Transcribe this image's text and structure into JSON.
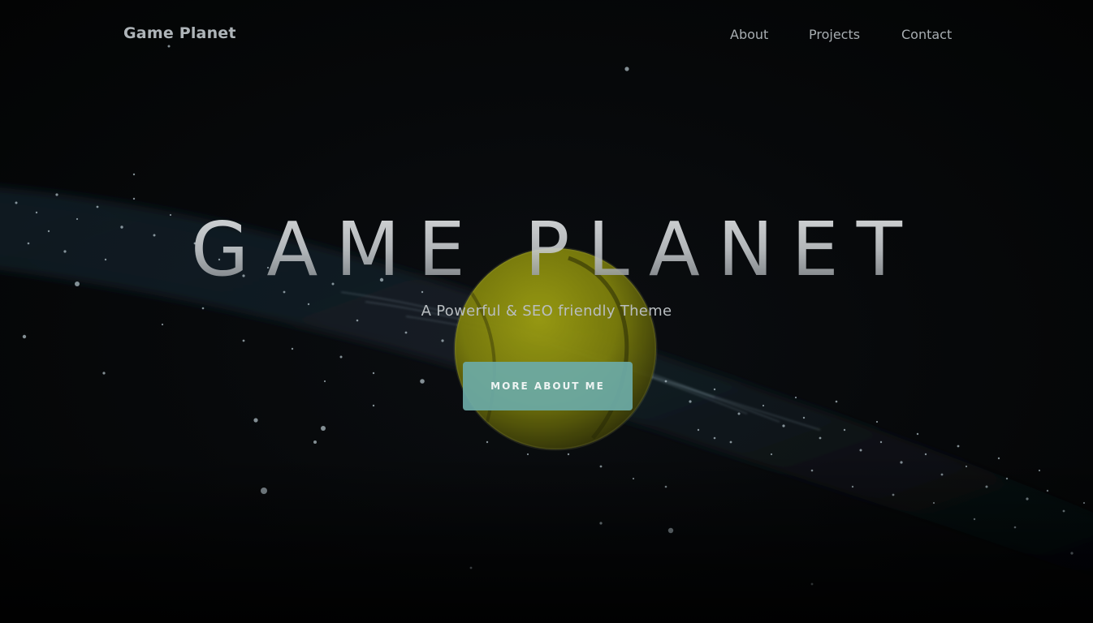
{
  "navbar": {
    "brand": "Game Planet",
    "links": [
      {
        "label": "About"
      },
      {
        "label": "Projects"
      },
      {
        "label": "Contact"
      }
    ]
  },
  "hero": {
    "title": "GAME PLANET",
    "subtitle": "A Powerful & SEO friendly Theme",
    "cta_label": "MORE ABOUT ME"
  },
  "colors": {
    "background": "#050607",
    "accent_button": "#6caaa6",
    "ball": "#8a8c10",
    "nav_text": "#a7adb1"
  }
}
